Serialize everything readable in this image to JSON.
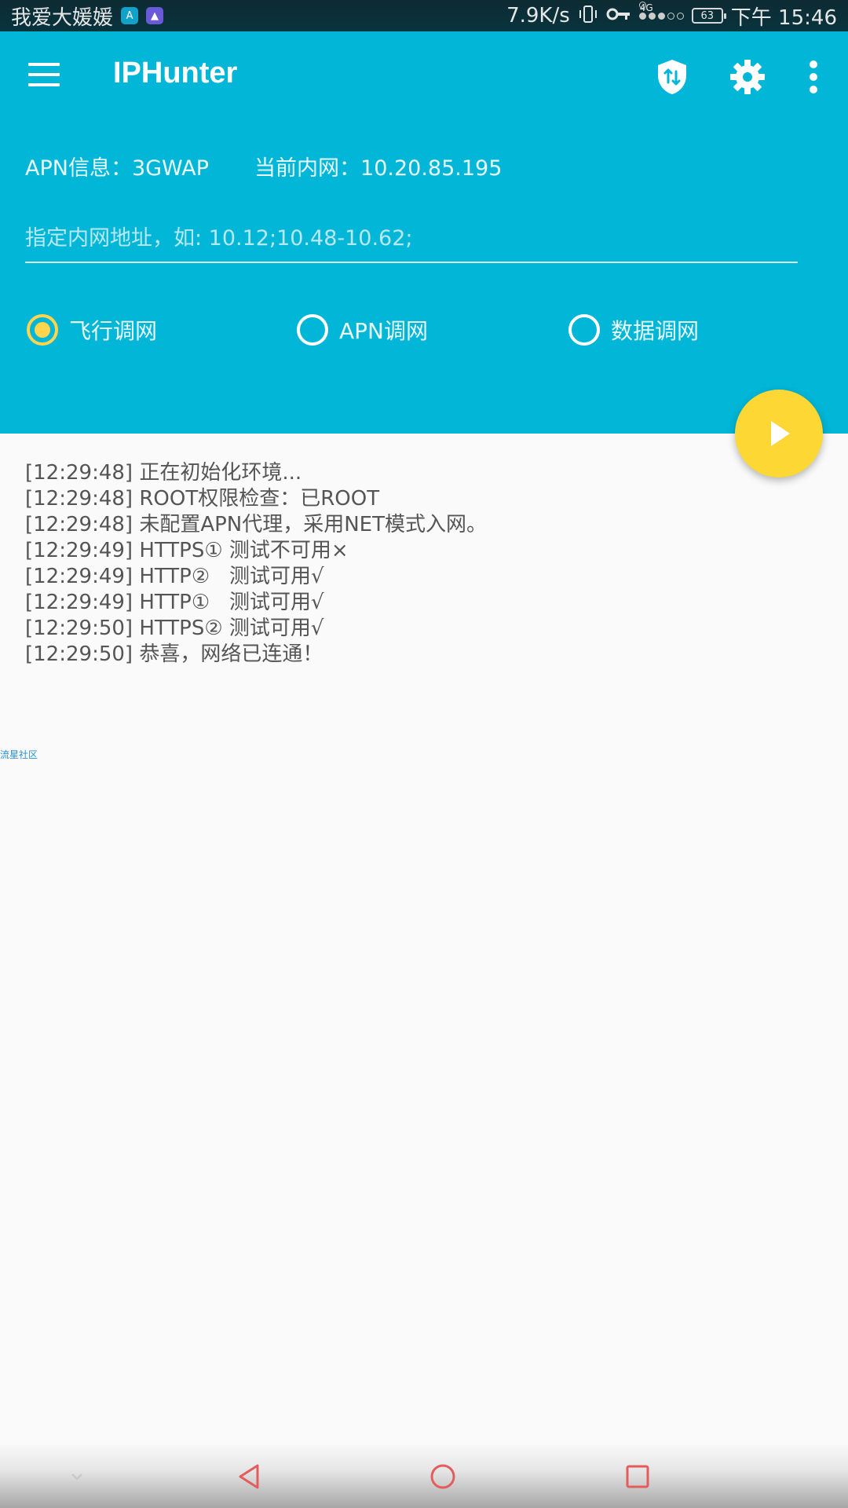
{
  "status_bar": {
    "carrier_text": "我爱大媛媛",
    "net_speed": "7.9K/s",
    "network_type": "4G",
    "battery_level": "63",
    "time": "下午 15:46",
    "icons": [
      "app-icon-a",
      "app-icon-b",
      "vibrate-icon",
      "vpn-key-icon",
      "signal-icon",
      "battery-icon"
    ]
  },
  "toolbar": {
    "title": "IPHunter",
    "icons": [
      "menu-icon",
      "shield-vpn-icon",
      "gear-icon",
      "more-vert-icon"
    ]
  },
  "info": {
    "apn": "APN信息：3GWAP",
    "current_ip": "当前内网：10.20.85.195"
  },
  "ip_input": {
    "placeholder": "指定内网地址，如: 10.12;10.48-10.62;",
    "value": ""
  },
  "radio_options": [
    {
      "label": "飞行调网",
      "checked": true
    },
    {
      "label": "APN调网",
      "checked": false
    },
    {
      "label": "数据调网",
      "checked": false
    }
  ],
  "fab": {
    "icon": "play-icon"
  },
  "log_lines": [
    "[12:29:48] 正在初始化环境...",
    "[12:29:48] ROOT权限检查：已ROOT",
    "[12:29:48] 未配置APN代理，采用NET模式入网。",
    "[12:29:49] HTTPS① 测试不可用×",
    "[12:29:49] HTTP②   测试可用√",
    "[12:29:49] HTTP①   测试可用√",
    "[12:29:50] HTTPS② 测试可用√",
    "[12:29:50] 恭喜，网络已连通！"
  ],
  "watermark": "流星社区",
  "colors": {
    "primary": "#01b6d7",
    "accent": "#fdd835",
    "radio_checked": "#ffd54f",
    "nav_icon": "#e35d5d"
  },
  "nav_bar": {
    "icons": [
      "chevron-down-icon",
      "back-icon",
      "home-icon",
      "recent-apps-icon"
    ]
  }
}
